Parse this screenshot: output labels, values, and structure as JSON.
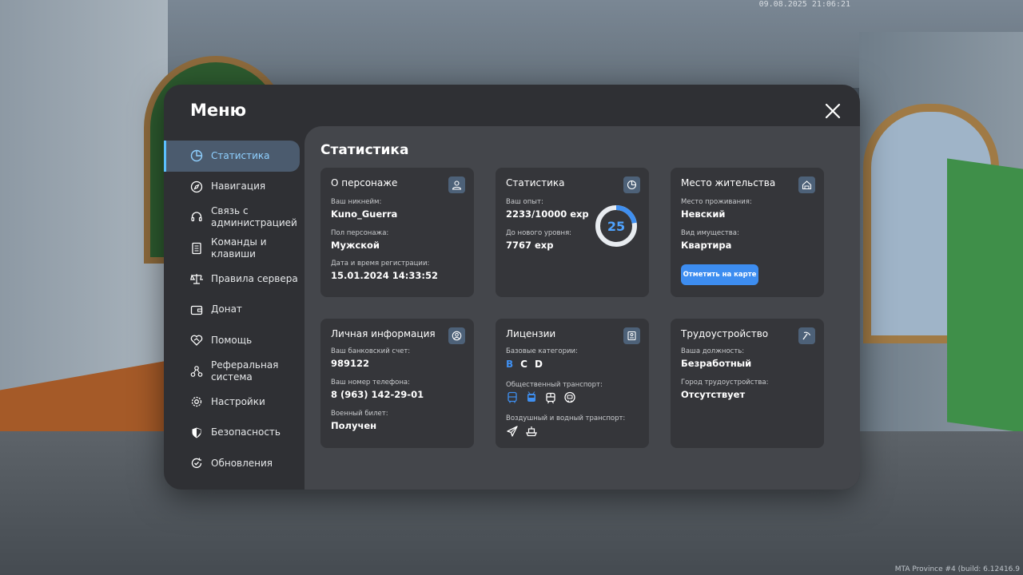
{
  "overlay": {
    "timestamp": "09.08.2025 21:06:21",
    "build": "MTA Province #4 (build: 6.12416.9"
  },
  "menu": {
    "title": "Меню",
    "close_icon": "close-icon"
  },
  "sidebar": {
    "items": [
      {
        "label": "Статистика",
        "icon": "pie-chart-icon",
        "active": true
      },
      {
        "label": "Навигация",
        "icon": "compass-icon"
      },
      {
        "label": "Связь с администрацией",
        "icon": "headset-icon"
      },
      {
        "label": "Команды и клавиши",
        "icon": "document-icon"
      },
      {
        "label": "Правила сервера",
        "icon": "scales-icon"
      },
      {
        "label": "Донат",
        "icon": "wallet-icon"
      },
      {
        "label": "Помощь",
        "icon": "handshake-icon"
      },
      {
        "label": "Реферальная система",
        "icon": "network-icon"
      },
      {
        "label": "Настройки",
        "icon": "gear-icon"
      },
      {
        "label": "Безопасность",
        "icon": "shield-icon"
      },
      {
        "label": "Обновления",
        "icon": "refresh-check-icon"
      }
    ]
  },
  "content": {
    "title": "Статистика",
    "character": {
      "title": "О персонаже",
      "icon": "user-icon",
      "nickname_label": "Ваш никнейм:",
      "nickname": "Kuno_Guerra",
      "gender_label": "Пол персонажа:",
      "gender": "Мужской",
      "reg_label": "Дата и время регистрации:",
      "reg_date": "15.01.2024 14:33:52"
    },
    "stats": {
      "title": "Статистика",
      "icon": "pie-chart-icon",
      "exp_label": "Ваш опыт:",
      "exp": "2233/10000 exp",
      "next_label": "До нового уровня:",
      "next": "7767 exp",
      "level": "25",
      "progress": 0.2233,
      "accent": "#3f8ff0"
    },
    "residence": {
      "title": "Место жительства",
      "icon": "home-icon",
      "place_label": "Место проживания:",
      "place": "Невский",
      "property_label": "Вид имущества:",
      "property": "Квартира",
      "map_button": "Отметить на карте"
    },
    "personal": {
      "title": "Личная информация",
      "icon": "user-circle-icon",
      "bank_label": "Ваш банковский счет:",
      "bank": "989122",
      "phone_label": "Ваш номер телефона:",
      "phone": "8 (963) 142-29-01",
      "military_label": "Военный билет:",
      "military": "Получен"
    },
    "licenses": {
      "title": "Лицензии",
      "icon": "id-card-icon",
      "base_label": "Базовые категории:",
      "categories": [
        {
          "label": "B",
          "has": true
        },
        {
          "label": "C",
          "has": false
        },
        {
          "label": "D",
          "has": false
        }
      ],
      "public_label": "Общественный транспорт:",
      "public_icons": [
        "bus-icon",
        "trolleybus-icon",
        "tram-icon",
        "metro-icon"
      ],
      "air_label": "Воздушный и водный транспорт:",
      "air_icons": [
        "plane-icon",
        "ship-icon"
      ]
    },
    "employment": {
      "title": "Трудоустройство",
      "icon": "pickaxe-icon",
      "position_label": "Ваша должность:",
      "position": "Безработный",
      "city_label": "Город трудоустройства:",
      "city": "Отсутствует"
    }
  }
}
